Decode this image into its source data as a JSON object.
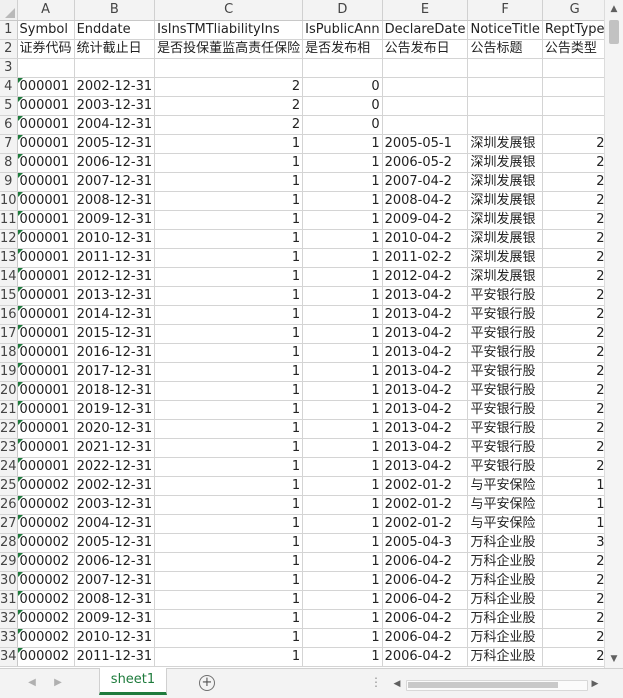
{
  "columns": [
    "A",
    "B",
    "C",
    "D",
    "E",
    "F",
    "G"
  ],
  "row_numbers": [
    "1",
    "2",
    "3",
    "4",
    "5",
    "6",
    "7",
    "8",
    "9",
    "10",
    "11",
    "12",
    "13",
    "14",
    "15",
    "16",
    "17",
    "18",
    "19",
    "20",
    "21",
    "22",
    "23",
    "24",
    "25",
    "26",
    "27",
    "28",
    "29",
    "30",
    "31",
    "32",
    "33",
    "34"
  ],
  "rows": [
    [
      "Symbol",
      "Enddate",
      "IsInsTMTliabilityIns",
      "IsPublicAnn",
      "DeclareDate",
      "NoticeTitle",
      "ReptType"
    ],
    [
      "证券代码",
      "统计截止日",
      "是否投保董监高责任保险",
      "是否发布相",
      "公告发布日",
      "公告标题",
      "公告类型"
    ],
    [
      "",
      "",
      "",
      "",
      "",
      "",
      ""
    ],
    [
      "000001",
      "2002-12-31",
      "2",
      "0",
      "",
      "",
      ""
    ],
    [
      "000001",
      "2003-12-31",
      "2",
      "0",
      "",
      "",
      ""
    ],
    [
      "000001",
      "2004-12-31",
      "2",
      "0",
      "",
      "",
      ""
    ],
    [
      "000001",
      "2005-12-31",
      "1",
      "1",
      "2005-05-1",
      "深圳发展银",
      "2"
    ],
    [
      "000001",
      "2006-12-31",
      "1",
      "1",
      "2006-05-2",
      "深圳发展银",
      "2"
    ],
    [
      "000001",
      "2007-12-31",
      "1",
      "1",
      "2007-04-2",
      "深圳发展银",
      "2"
    ],
    [
      "000001",
      "2008-12-31",
      "1",
      "1",
      "2008-04-2",
      "深圳发展银",
      "2"
    ],
    [
      "000001",
      "2009-12-31",
      "1",
      "1",
      "2009-04-2",
      "深圳发展银",
      "2"
    ],
    [
      "000001",
      "2010-12-31",
      "1",
      "1",
      "2010-04-2",
      "深圳发展银",
      "2"
    ],
    [
      "000001",
      "2011-12-31",
      "1",
      "1",
      "2011-02-2",
      "深圳发展银",
      "2"
    ],
    [
      "000001",
      "2012-12-31",
      "1",
      "1",
      "2012-04-2",
      "深圳发展银",
      "2"
    ],
    [
      "000001",
      "2013-12-31",
      "1",
      "1",
      "2013-04-2",
      "平安银行股",
      "2"
    ],
    [
      "000001",
      "2014-12-31",
      "1",
      "1",
      "2013-04-2",
      "平安银行股",
      "2"
    ],
    [
      "000001",
      "2015-12-31",
      "1",
      "1",
      "2013-04-2",
      "平安银行股",
      "2"
    ],
    [
      "000001",
      "2016-12-31",
      "1",
      "1",
      "2013-04-2",
      "平安银行股",
      "2"
    ],
    [
      "000001",
      "2017-12-31",
      "1",
      "1",
      "2013-04-2",
      "平安银行股",
      "2"
    ],
    [
      "000001",
      "2018-12-31",
      "1",
      "1",
      "2013-04-2",
      "平安银行股",
      "2"
    ],
    [
      "000001",
      "2019-12-31",
      "1",
      "1",
      "2013-04-2",
      "平安银行股",
      "2"
    ],
    [
      "000001",
      "2020-12-31",
      "1",
      "1",
      "2013-04-2",
      "平安银行股",
      "2"
    ],
    [
      "000001",
      "2021-12-31",
      "1",
      "1",
      "2013-04-2",
      "平安银行股",
      "2"
    ],
    [
      "000001",
      "2022-12-31",
      "1",
      "1",
      "2013-04-2",
      "平安银行股",
      "2"
    ],
    [
      "000002",
      "2002-12-31",
      "1",
      "1",
      "2002-01-2",
      "与平安保险",
      "1"
    ],
    [
      "000002",
      "2003-12-31",
      "1",
      "1",
      "2002-01-2",
      "与平安保险",
      "1"
    ],
    [
      "000002",
      "2004-12-31",
      "1",
      "1",
      "2002-01-2",
      "与平安保险",
      "1"
    ],
    [
      "000002",
      "2005-12-31",
      "1",
      "1",
      "2005-04-3",
      "万科企业股",
      "3"
    ],
    [
      "000002",
      "2006-12-31",
      "1",
      "1",
      "2006-04-2",
      "万科企业股",
      "2"
    ],
    [
      "000002",
      "2007-12-31",
      "1",
      "1",
      "2006-04-2",
      "万科企业股",
      "2"
    ],
    [
      "000002",
      "2008-12-31",
      "1",
      "1",
      "2006-04-2",
      "万科企业股",
      "2"
    ],
    [
      "000002",
      "2009-12-31",
      "1",
      "1",
      "2006-04-2",
      "万科企业股",
      "2"
    ],
    [
      "000002",
      "2010-12-31",
      "1",
      "1",
      "2006-04-2",
      "万科企业股",
      "2"
    ],
    [
      "000002",
      "2011-12-31",
      "1",
      "1",
      "2006-04-2",
      "万科企业股",
      "2"
    ]
  ],
  "sheet_tabs": [
    {
      "label": "sheet1",
      "active": true
    }
  ],
  "icons": {
    "add_sheet": "plus-circle-icon",
    "scroll_up": "triangle-up-icon",
    "scroll_down": "triangle-down-icon",
    "scroll_left": "triangle-left-icon",
    "scroll_right": "triangle-right-icon",
    "sheet_nav_prev": "chevron-left-icon",
    "sheet_nav_next": "chevron-right-icon",
    "more": "ellipsis-icon"
  },
  "colors": {
    "accent": "#1e7b3c",
    "header_bg": "#f3f3f3",
    "gridline": "#d4d4d4"
  }
}
